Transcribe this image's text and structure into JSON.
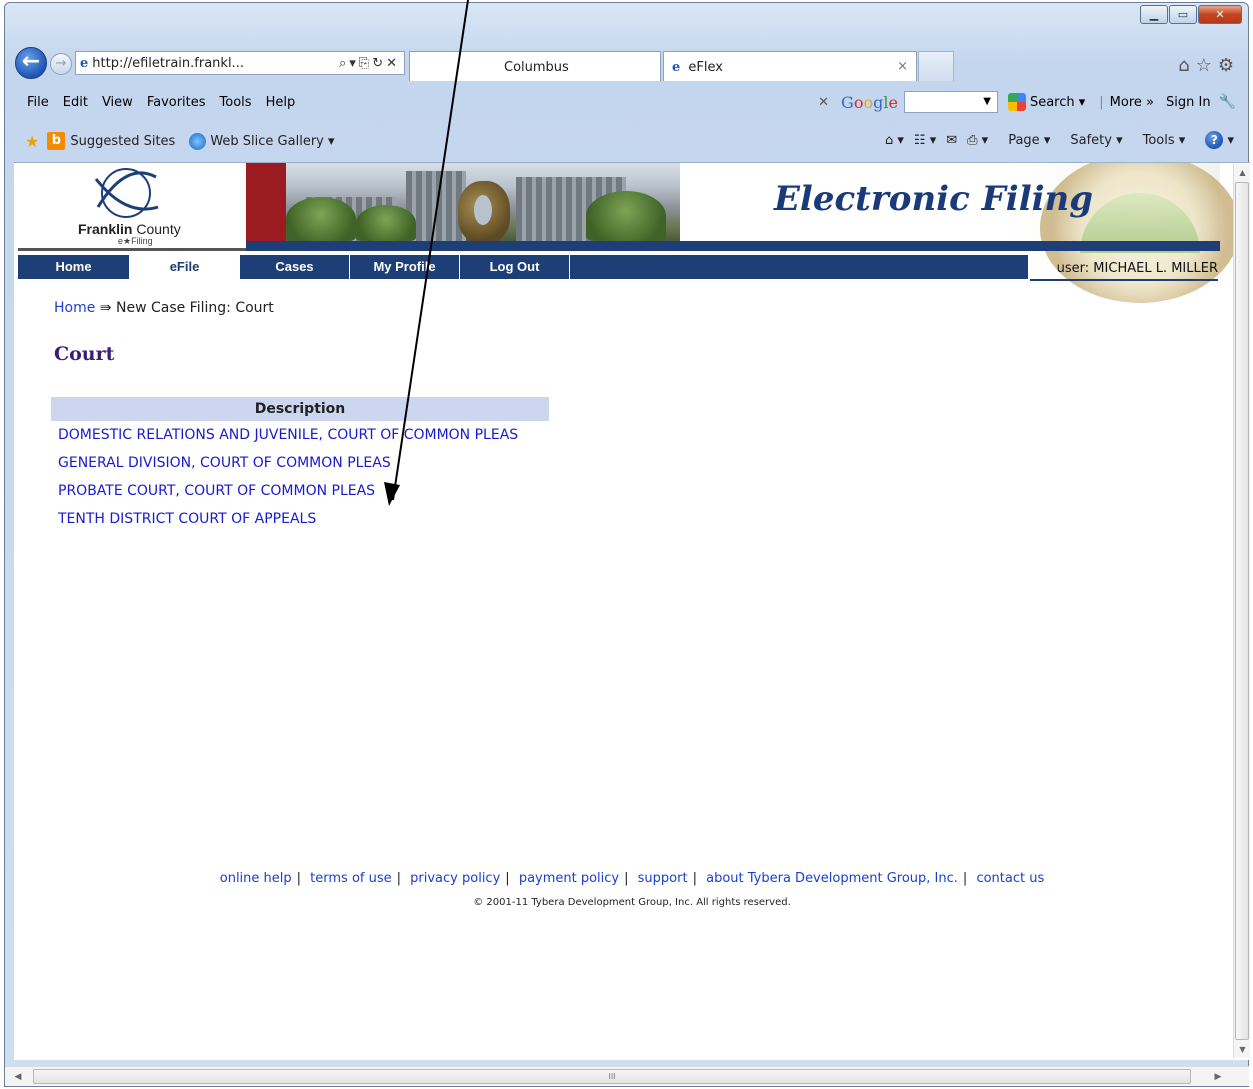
{
  "browser": {
    "address": "http://efiletrain.frankl...",
    "tabs": [
      {
        "label": "Columbus"
      },
      {
        "label": "eFlex"
      }
    ],
    "menu": [
      "File",
      "Edit",
      "View",
      "Favorites",
      "Tools",
      "Help"
    ],
    "google": {
      "logo": "Google",
      "search_label": "Search",
      "more_label": "More »",
      "signin_label": "Sign In"
    },
    "favorites": {
      "suggested": "Suggested Sites",
      "webslice": "Web Slice Gallery"
    },
    "commands": {
      "page": "Page",
      "safety": "Safety",
      "tools": "Tools"
    }
  },
  "site": {
    "logo_main": "Franklin",
    "logo_county": "County",
    "logo_sub": "e★Filing",
    "title": "Electronic Filing",
    "nav": [
      {
        "label": "Home",
        "active": false
      },
      {
        "label": "eFile",
        "active": true
      },
      {
        "label": "Cases",
        "active": false
      },
      {
        "label": "My Profile",
        "active": false
      },
      {
        "label": "Log Out",
        "active": false
      }
    ],
    "user": "user: MICHAEL L. MILLER"
  },
  "breadcrumb": {
    "home": "Home",
    "separator": " ⇛ ",
    "current": "New Case Filing: Court"
  },
  "page_title": "Court",
  "table": {
    "header": "Description",
    "rows": [
      "DOMESTIC RELATIONS AND JUVENILE, COURT OF COMMON PLEAS",
      "GENERAL DIVISION, COURT OF COMMON PLEAS",
      "PROBATE COURT, COURT OF COMMON PLEAS",
      "TENTH DISTRICT COURT OF APPEALS"
    ]
  },
  "footer": {
    "links": [
      "online help",
      "terms of use",
      "privacy policy",
      "payment policy",
      "support",
      "about Tybera Development Group, Inc.",
      "contact us"
    ],
    "separator": "|",
    "copyright": "© 2001-11 Tybera Development Group, Inc. All rights reserved."
  },
  "colors": {
    "nav": "#1d3e77",
    "title": "#3b1c78",
    "link": "#1a1ad0",
    "header_band": "#9b1b21"
  }
}
